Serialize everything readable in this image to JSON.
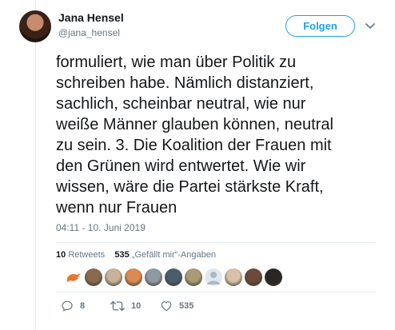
{
  "author": {
    "name": "Jana Hensel",
    "handle": "@jana_hensel"
  },
  "follow_label": "Folgen",
  "tweet": {
    "lines": [
      "formuliert, wie man über Politik zu",
      "schreiben habe. Nämlich distanziert,",
      "sachlich, scheinbar neutral, wie nur",
      "weiße Männer glauben können, neutral",
      "zu sein. 3. Die Koalition der Frauen mit",
      "den Grünen wird entwertet. Wie wir",
      "wissen, wäre die Partei stärkste Kraft,",
      "wenn nur Frauen"
    ],
    "timestamp": "04:11 - 10. Juni 2019"
  },
  "stats": {
    "retweets_count": "10",
    "retweets_label": "Retweets",
    "likes_count": "535",
    "likes_label": "„Gefällt mir“-Angaben"
  },
  "likers": [
    {
      "icon": "avatar-orange-bird",
      "color": "#e8762b"
    },
    {
      "icon": "avatar-photo",
      "color": "#8a6a4d"
    },
    {
      "icon": "avatar-photo",
      "color": "#c7b29a"
    },
    {
      "icon": "avatar-photo",
      "color": "#d98b53"
    },
    {
      "icon": "avatar-photo",
      "color": "#8e9aa3"
    },
    {
      "icon": "avatar-photo",
      "color": "#4b5d6b"
    },
    {
      "icon": "avatar-photo",
      "color": "#a89a72"
    },
    {
      "icon": "avatar-default",
      "color": "#a9b8c4"
    },
    {
      "icon": "avatar-photo",
      "color": "#d9c0a8"
    },
    {
      "icon": "avatar-photo",
      "color": "#6b4a3a"
    },
    {
      "icon": "avatar-photo",
      "color": "#2a2624"
    }
  ],
  "actions": {
    "reply_count": "8",
    "retweet_count": "10",
    "like_count": "535"
  },
  "colors": {
    "accent": "#1da1f2",
    "muted": "#657786",
    "text": "#14171a"
  }
}
